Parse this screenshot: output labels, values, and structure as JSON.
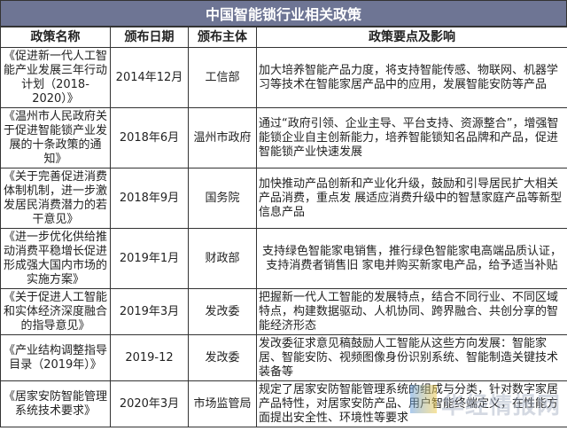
{
  "title": "中国智能锁行业相关政策",
  "headers": [
    "政策名称",
    "颁布日期",
    "颁布主体",
    "政策要点及影响"
  ],
  "rows": [
    {
      "name": "《促进新一代人工智能产业发展三年行动计划（2018-2020）》",
      "date": "2014年12月",
      "issuer": "工信部",
      "impact": "加大培养智能产品力度，将支持智能传感、物联网、机器学习等技术在智能家居产品中的应用，发展智能安防等产品"
    },
    {
      "name": "《温州市人民政府关于促进智能锁产业发展的十条政策的通知》",
      "date": "2018年6月",
      "issuer": "温州市政府",
      "impact": "通过“政府引领、企业主导、平台支持、资源整合”，增强智能锁企业自主创新能力，培养智能锁知名品牌和产品，促进智能锁产业快速发展"
    },
    {
      "name": "《关于完善促进消费体制机制，进一步激发居民消费潜力的若干意见》",
      "date": "2018年9月",
      "issuer": "国务院",
      "impact": "加快推动产品创新和产业化升级，鼓励和引导居民扩大相关产品消费，重点发 展适应消费升级中的智慧家庭产品等新型信息产品"
    },
    {
      "name": "《进一步优化供给推动消费平稳增长促进形成强大国内市场的实施方案》",
      "date": "2019年1月",
      "issuer": "财政部",
      "impact": "支持绿色智能家电销售，推行绿色智能家电高端品质认证，支持消费者销售旧 家电并购买新家电产品，给予适当补贴"
    },
    {
      "name": "《关于促进人工智能和实体经济深度融合的指导意见》",
      "date": "2019年3月",
      "issuer": "发改委",
      "impact": "把握新一代人工智能的发展特点，结合不同行业、不同区域特点，构建数据驱动、人机协同、跨界融合、共创分享的智能经济形态"
    },
    {
      "name": "《产业结构调整指导目录（2019年）》",
      "date": "2019-12",
      "issuer": "发改委",
      "impact": "发改委征求意见稿鼓励人工智能从这些方向发展：智能家居、智能安防、视频图像身份识别系统、智能制造关键技术装备等"
    },
    {
      "name": "《居家安防智能管理系统技术要求》",
      "date": "2020年3月",
      "issuer": "市场监管局",
      "impact": "规定了居家安防智能管理系统的组成与分类，针对数字家居产品特性，对居家安防产品、用户智能终端定义，在性能方面提出安全性、环境性等要求"
    }
  ],
  "watermark": "华经情报网",
  "colors": {
    "title_bar": "#6e7594",
    "border": "#333333"
  }
}
